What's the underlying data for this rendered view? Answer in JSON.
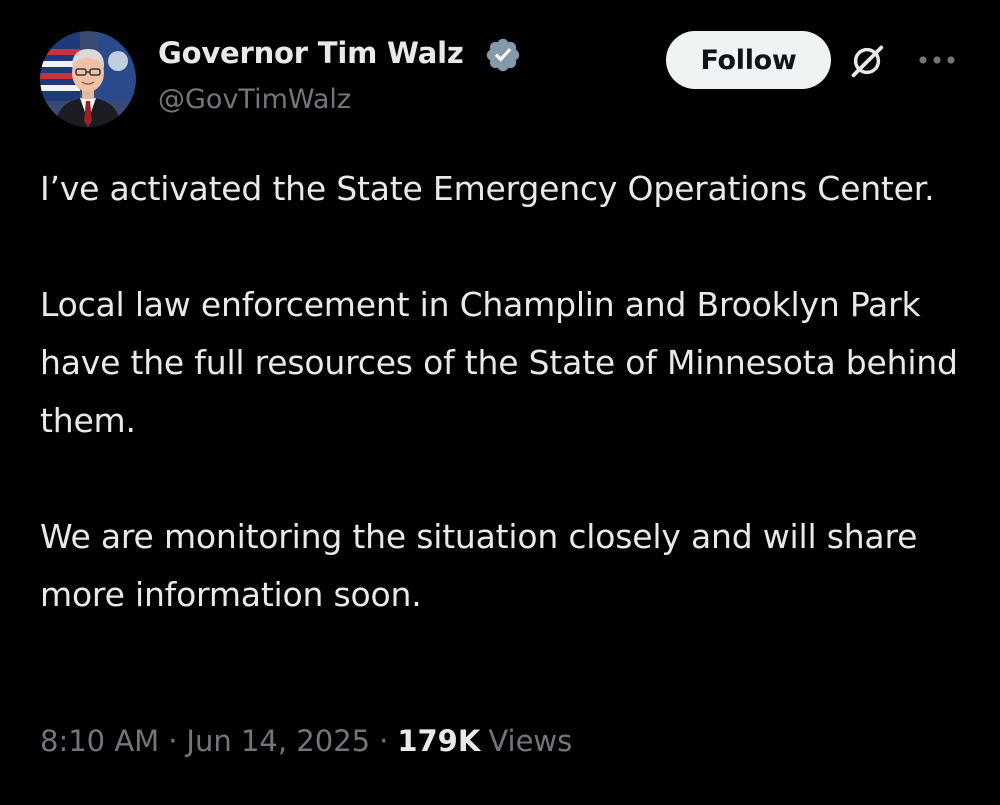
{
  "author": {
    "display_name": "Governor Tim Walz",
    "handle": "@GovTimWalz",
    "verified": true,
    "avatar_icon": "profile-photo",
    "verified_color": "#829aab"
  },
  "actions": {
    "follow_label": "Follow",
    "grok_icon": "grok-icon",
    "more_icon": "more-options-icon"
  },
  "tweet": {
    "paragraphs": [
      "I’ve activated the State Emergency Operations Center.",
      "Local law enforcement in Champlin and Brooklyn Park have the full resources of the State of Minnesota behind them.",
      "We are monitoring the situation closely and will share more information soon."
    ]
  },
  "meta": {
    "time": "8:10 AM",
    "separator": "·",
    "date": "Jun 14, 2025",
    "views_count": "179K",
    "views_label": "Views"
  },
  "colors": {
    "background": "#000000",
    "text_primary": "#e7e9ea",
    "text_secondary": "#71767b",
    "button_bg": "#eff3f4"
  }
}
